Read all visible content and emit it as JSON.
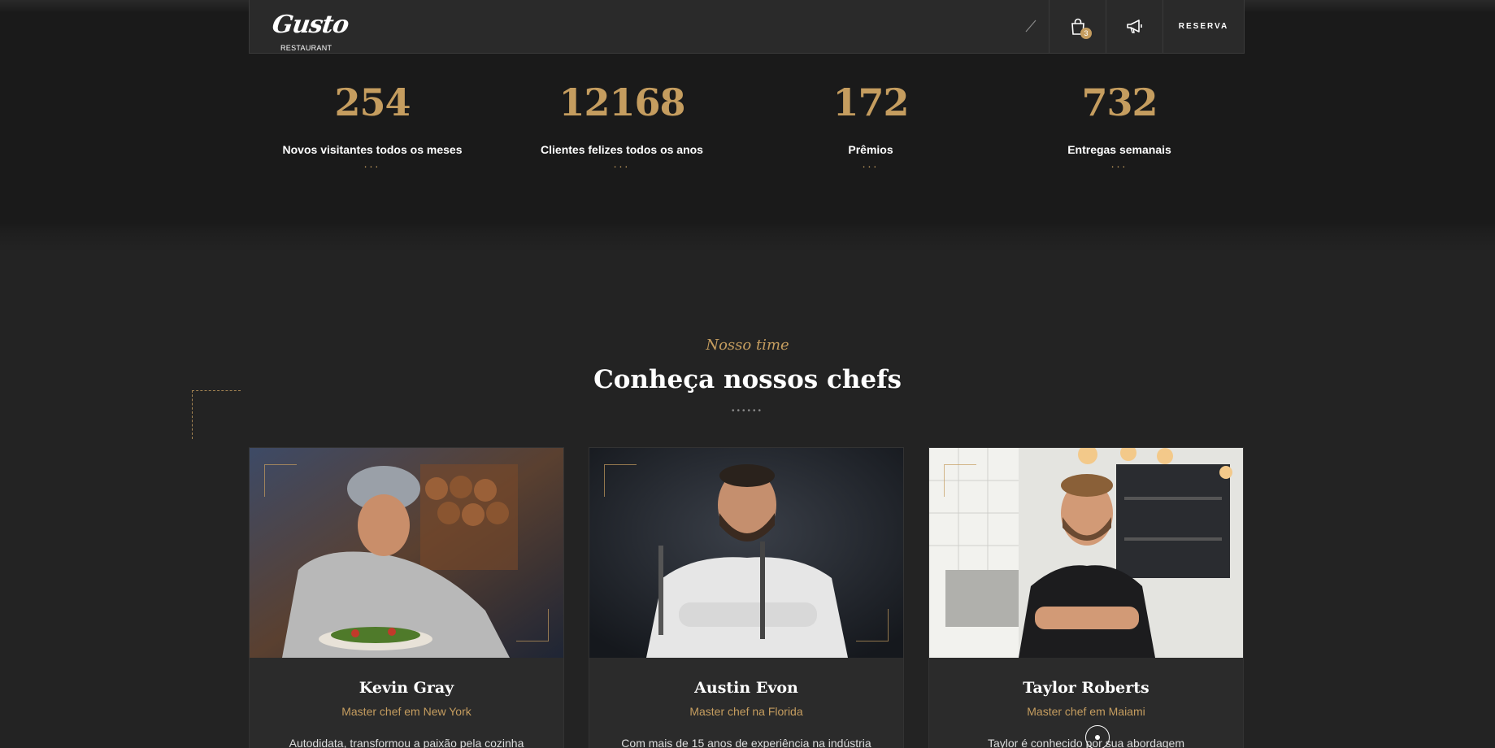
{
  "header": {
    "logo_text": "Gusto",
    "logo_sub": "RESTAURANT",
    "cart_count": "3",
    "reserva_label": "RESERVA"
  },
  "stats": [
    {
      "number": "254",
      "label": "Novos visitantes todos os meses",
      "dots": "..."
    },
    {
      "number": "12168",
      "label": "Clientes felizes todos os anos",
      "dots": "..."
    },
    {
      "number": "172",
      "label": "Prêmios",
      "dots": "..."
    },
    {
      "number": "732",
      "label": "Entregas semanais",
      "dots": "..."
    }
  ],
  "team": {
    "subtitle": "Nosso time",
    "title": "Conheça nossos chefs",
    "dots": "••••••"
  },
  "chefs": [
    {
      "name": "Kevin Gray",
      "role": "Master chef em New York",
      "bio": "Autodidata, transformou a paixão pela cozinha"
    },
    {
      "name": "Austin Evon",
      "role": "Master chef na Florida",
      "bio": "Com mais de 15 anos de experiência na indústria"
    },
    {
      "name": "Taylor Roberts",
      "role": "Master chef em Maiami",
      "bio": "Taylor é conhecido por sua abordagem"
    }
  ],
  "colors": {
    "accent": "#c59d5f",
    "background": "#232323",
    "band": "#1a1a1a"
  },
  "icons": [
    "slash-icon",
    "shopping-bag-icon",
    "megaphone-icon"
  ]
}
